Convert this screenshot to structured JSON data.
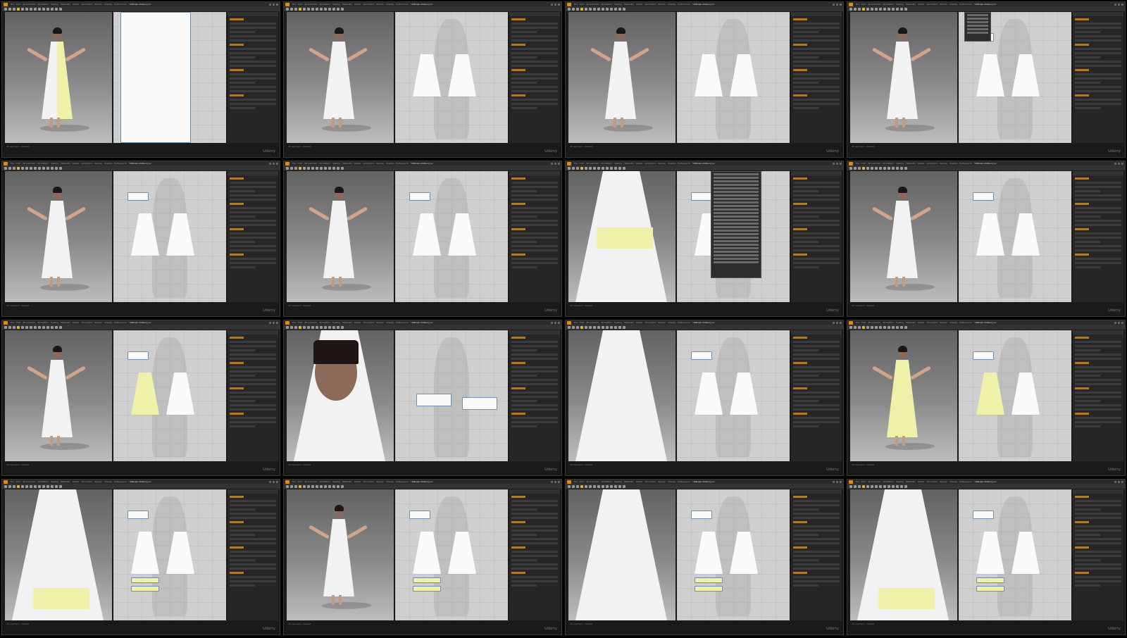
{
  "app": {
    "title": "Marvelous Designer",
    "menu": [
      "File",
      "Edit",
      "3D Garment",
      "2D Pattern",
      "Sewing",
      "Materials",
      "Avatar",
      "Simulation",
      "Render",
      "Display",
      "Preferences",
      "Settings",
      "Help"
    ],
    "watermark": "Udemy",
    "status": "3D Garment - Default"
  },
  "colors": {
    "accent": "#e3b13a",
    "fabric_white": "#f2f2f2",
    "fabric_yellow": "#eef2a8",
    "viewport_2d": "#cfcfcf"
  },
  "frames": [
    {
      "id": 1,
      "scene": "front view, half-yellow tunic"
    },
    {
      "id": 2,
      "scene": "back view with menu"
    },
    {
      "id": 3,
      "scene": "front with flat pieces"
    },
    {
      "id": 4,
      "scene": "front with sleeve piece"
    },
    {
      "id": 5,
      "scene": "three-quarter long sleeve"
    },
    {
      "id": 6,
      "scene": "front long sleeve dress"
    },
    {
      "id": 7,
      "scene": "close-up yellow ruffle with context menu"
    },
    {
      "id": 8,
      "scene": "front with ruffle"
    },
    {
      "id": 9,
      "scene": "three-quarter ruffle"
    },
    {
      "id": 10,
      "scene": "portrait close-up"
    },
    {
      "id": 11,
      "scene": "close-up ruffle detail"
    },
    {
      "id": 12,
      "scene": "yellow upper dress"
    },
    {
      "id": 13,
      "scene": "close-up hem yellow"
    },
    {
      "id": 14,
      "scene": "side view with menu"
    },
    {
      "id": 15,
      "scene": "close-up leg hem"
    },
    {
      "id": 16,
      "scene": "front hem yellow band"
    }
  ]
}
